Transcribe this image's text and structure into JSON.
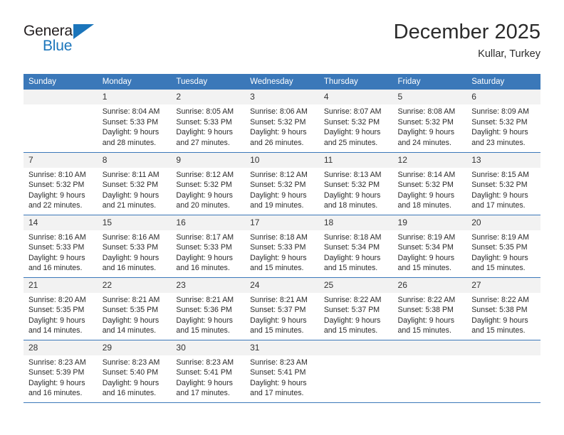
{
  "brand": {
    "name_top": "General",
    "name_bottom": "Blue",
    "color_blue": "#1b75bb",
    "color_dark": "#231f20"
  },
  "header": {
    "title": "December 2025",
    "subtitle": "Kullar, Turkey"
  },
  "theme": {
    "header_bar": "#3b78b9",
    "daynum_bg": "#f2f2f2",
    "text": "#2a2a2a"
  },
  "weekday_headers": [
    "Sunday",
    "Monday",
    "Tuesday",
    "Wednesday",
    "Thursday",
    "Friday",
    "Saturday"
  ],
  "labels": {
    "sunrise_prefix": "Sunrise:",
    "sunset_prefix": "Sunset:",
    "daylight_prefix": "Daylight:"
  },
  "weeks": [
    [
      {
        "day": "",
        "sunrise": "",
        "sunset": "",
        "daylight": ""
      },
      {
        "day": "1",
        "sunrise": "Sunrise: 8:04 AM",
        "sunset": "Sunset: 5:33 PM",
        "daylight": "Daylight: 9 hours and 28 minutes."
      },
      {
        "day": "2",
        "sunrise": "Sunrise: 8:05 AM",
        "sunset": "Sunset: 5:33 PM",
        "daylight": "Daylight: 9 hours and 27 minutes."
      },
      {
        "day": "3",
        "sunrise": "Sunrise: 8:06 AM",
        "sunset": "Sunset: 5:32 PM",
        "daylight": "Daylight: 9 hours and 26 minutes."
      },
      {
        "day": "4",
        "sunrise": "Sunrise: 8:07 AM",
        "sunset": "Sunset: 5:32 PM",
        "daylight": "Daylight: 9 hours and 25 minutes."
      },
      {
        "day": "5",
        "sunrise": "Sunrise: 8:08 AM",
        "sunset": "Sunset: 5:32 PM",
        "daylight": "Daylight: 9 hours and 24 minutes."
      },
      {
        "day": "6",
        "sunrise": "Sunrise: 8:09 AM",
        "sunset": "Sunset: 5:32 PM",
        "daylight": "Daylight: 9 hours and 23 minutes."
      }
    ],
    [
      {
        "day": "7",
        "sunrise": "Sunrise: 8:10 AM",
        "sunset": "Sunset: 5:32 PM",
        "daylight": "Daylight: 9 hours and 22 minutes."
      },
      {
        "day": "8",
        "sunrise": "Sunrise: 8:11 AM",
        "sunset": "Sunset: 5:32 PM",
        "daylight": "Daylight: 9 hours and 21 minutes."
      },
      {
        "day": "9",
        "sunrise": "Sunrise: 8:12 AM",
        "sunset": "Sunset: 5:32 PM",
        "daylight": "Daylight: 9 hours and 20 minutes."
      },
      {
        "day": "10",
        "sunrise": "Sunrise: 8:12 AM",
        "sunset": "Sunset: 5:32 PM",
        "daylight": "Daylight: 9 hours and 19 minutes."
      },
      {
        "day": "11",
        "sunrise": "Sunrise: 8:13 AM",
        "sunset": "Sunset: 5:32 PM",
        "daylight": "Daylight: 9 hours and 18 minutes."
      },
      {
        "day": "12",
        "sunrise": "Sunrise: 8:14 AM",
        "sunset": "Sunset: 5:32 PM",
        "daylight": "Daylight: 9 hours and 18 minutes."
      },
      {
        "day": "13",
        "sunrise": "Sunrise: 8:15 AM",
        "sunset": "Sunset: 5:32 PM",
        "daylight": "Daylight: 9 hours and 17 minutes."
      }
    ],
    [
      {
        "day": "14",
        "sunrise": "Sunrise: 8:16 AM",
        "sunset": "Sunset: 5:33 PM",
        "daylight": "Daylight: 9 hours and 16 minutes."
      },
      {
        "day": "15",
        "sunrise": "Sunrise: 8:16 AM",
        "sunset": "Sunset: 5:33 PM",
        "daylight": "Daylight: 9 hours and 16 minutes."
      },
      {
        "day": "16",
        "sunrise": "Sunrise: 8:17 AM",
        "sunset": "Sunset: 5:33 PM",
        "daylight": "Daylight: 9 hours and 16 minutes."
      },
      {
        "day": "17",
        "sunrise": "Sunrise: 8:18 AM",
        "sunset": "Sunset: 5:33 PM",
        "daylight": "Daylight: 9 hours and 15 minutes."
      },
      {
        "day": "18",
        "sunrise": "Sunrise: 8:18 AM",
        "sunset": "Sunset: 5:34 PM",
        "daylight": "Daylight: 9 hours and 15 minutes."
      },
      {
        "day": "19",
        "sunrise": "Sunrise: 8:19 AM",
        "sunset": "Sunset: 5:34 PM",
        "daylight": "Daylight: 9 hours and 15 minutes."
      },
      {
        "day": "20",
        "sunrise": "Sunrise: 8:19 AM",
        "sunset": "Sunset: 5:35 PM",
        "daylight": "Daylight: 9 hours and 15 minutes."
      }
    ],
    [
      {
        "day": "21",
        "sunrise": "Sunrise: 8:20 AM",
        "sunset": "Sunset: 5:35 PM",
        "daylight": "Daylight: 9 hours and 14 minutes."
      },
      {
        "day": "22",
        "sunrise": "Sunrise: 8:21 AM",
        "sunset": "Sunset: 5:35 PM",
        "daylight": "Daylight: 9 hours and 14 minutes."
      },
      {
        "day": "23",
        "sunrise": "Sunrise: 8:21 AM",
        "sunset": "Sunset: 5:36 PM",
        "daylight": "Daylight: 9 hours and 15 minutes."
      },
      {
        "day": "24",
        "sunrise": "Sunrise: 8:21 AM",
        "sunset": "Sunset: 5:37 PM",
        "daylight": "Daylight: 9 hours and 15 minutes."
      },
      {
        "day": "25",
        "sunrise": "Sunrise: 8:22 AM",
        "sunset": "Sunset: 5:37 PM",
        "daylight": "Daylight: 9 hours and 15 minutes."
      },
      {
        "day": "26",
        "sunrise": "Sunrise: 8:22 AM",
        "sunset": "Sunset: 5:38 PM",
        "daylight": "Daylight: 9 hours and 15 minutes."
      },
      {
        "day": "27",
        "sunrise": "Sunrise: 8:22 AM",
        "sunset": "Sunset: 5:38 PM",
        "daylight": "Daylight: 9 hours and 15 minutes."
      }
    ],
    [
      {
        "day": "28",
        "sunrise": "Sunrise: 8:23 AM",
        "sunset": "Sunset: 5:39 PM",
        "daylight": "Daylight: 9 hours and 16 minutes."
      },
      {
        "day": "29",
        "sunrise": "Sunrise: 8:23 AM",
        "sunset": "Sunset: 5:40 PM",
        "daylight": "Daylight: 9 hours and 16 minutes."
      },
      {
        "day": "30",
        "sunrise": "Sunrise: 8:23 AM",
        "sunset": "Sunset: 5:41 PM",
        "daylight": "Daylight: 9 hours and 17 minutes."
      },
      {
        "day": "31",
        "sunrise": "Sunrise: 8:23 AM",
        "sunset": "Sunset: 5:41 PM",
        "daylight": "Daylight: 9 hours and 17 minutes."
      },
      {
        "day": "",
        "sunrise": "",
        "sunset": "",
        "daylight": ""
      },
      {
        "day": "",
        "sunrise": "",
        "sunset": "",
        "daylight": ""
      },
      {
        "day": "",
        "sunrise": "",
        "sunset": "",
        "daylight": ""
      }
    ]
  ]
}
